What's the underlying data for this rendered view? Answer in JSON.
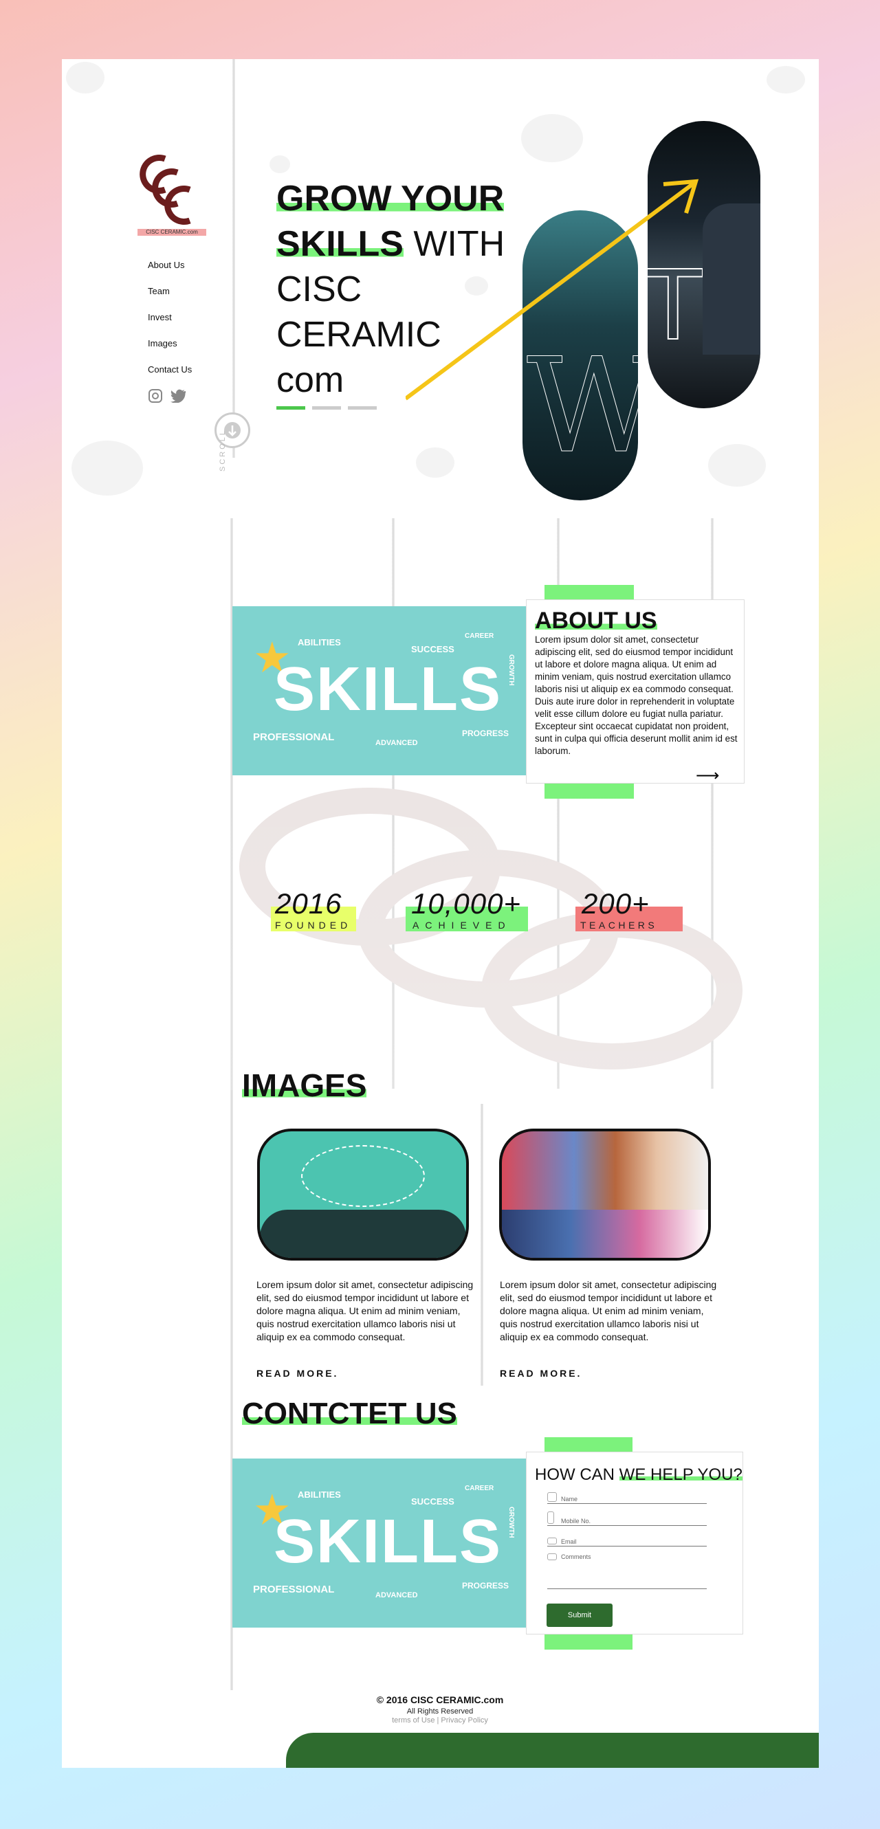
{
  "brand": {
    "tag": "CISC CERAMIC.com"
  },
  "nav": [
    "About Us",
    "Team",
    "Invest",
    "Images",
    "Contact Us"
  ],
  "social": [
    "instagram-icon",
    "twitter-icon"
  ],
  "scroll_label": "SCROLL",
  "hero": {
    "bold_line1": "GROW YOUR",
    "bold_line2": "SKILLS",
    "rest_line2": " WITH",
    "line3": "CISC",
    "line4": "CERAMIC",
    "line5": "com",
    "pill_letters": [
      "W",
      "TH"
    ]
  },
  "about": {
    "title": "ABOUT US",
    "text": "Lorem ipsum dolor sit amet, consectetur adipiscing elit, sed do eiusmod tempor incididunt ut labore et dolore magna aliqua. Ut enim ad minim veniam, quis nostrud exercitation ullamco laboris nisi ut aliquip ex ea commodo consequat. Duis aute irure dolor in reprehenderit in voluptate velit esse cillum dolore eu fugiat nulla pariatur. Excepteur sint occaecat cupidatat non proident, sunt in culpa qui officia deserunt mollit anim id est laborum.",
    "arrow": "⟶"
  },
  "skills_image": {
    "word": "SKILLS",
    "tags": [
      "ABILITIES",
      "SUCCESS",
      "CAREER",
      "GROWTH",
      "PROFESSIONAL",
      "ADVANCED",
      "PROGRESS"
    ]
  },
  "stats": [
    {
      "number": "2016",
      "label": "FOUNDED",
      "color": "#e8ff6a"
    },
    {
      "number": "10,000+",
      "label": "ACHIEVED",
      "color": "#7cf27c"
    },
    {
      "number": "200+",
      "label": "TEACHERS",
      "color": "#f27a7a"
    }
  ],
  "images": {
    "title": "IMAGES",
    "items": [
      {
        "text": "Lorem ipsum dolor sit amet, consectetur adipiscing elit, sed do eiusmod tempor incididunt ut labore et dolore magna aliqua. Ut enim ad minim veniam, quis nostrud exercitation ullamco laboris nisi ut aliquip ex ea commodo consequat.",
        "read_more": "READ MORE."
      },
      {
        "text": "Lorem ipsum dolor sit amet, consectetur adipiscing elit, sed do eiusmod tempor incididunt ut labore et dolore magna aliqua. Ut enim ad minim veniam, quis nostrud exercitation ullamco laboris nisi ut aliquip ex ea commodo consequat.",
        "read_more": "READ MORE."
      }
    ]
  },
  "contact": {
    "title": "CONTCTET US",
    "form_title_plain": "HOW CAN ",
    "form_title_highlight": "WE HELP YOU?",
    "fields": [
      {
        "label": "Name",
        "icon": "user-icon"
      },
      {
        "label": "Mobile No.",
        "icon": "phone-icon"
      },
      {
        "label": "Email",
        "icon": "mail-icon"
      },
      {
        "label": "Comments",
        "icon": "comment-icon"
      }
    ],
    "submit": "Submit"
  },
  "footer": {
    "copyright": "© 2016 CISC CERAMIC.com",
    "rights": "All Rights Reserved",
    "links": "terms of Use | Privacy Policy"
  },
  "colors": {
    "accent_green": "#7cf27c",
    "dark_green": "#2e6b2e",
    "teal": "#7fd3cf",
    "logo": "#6b1d1d"
  }
}
